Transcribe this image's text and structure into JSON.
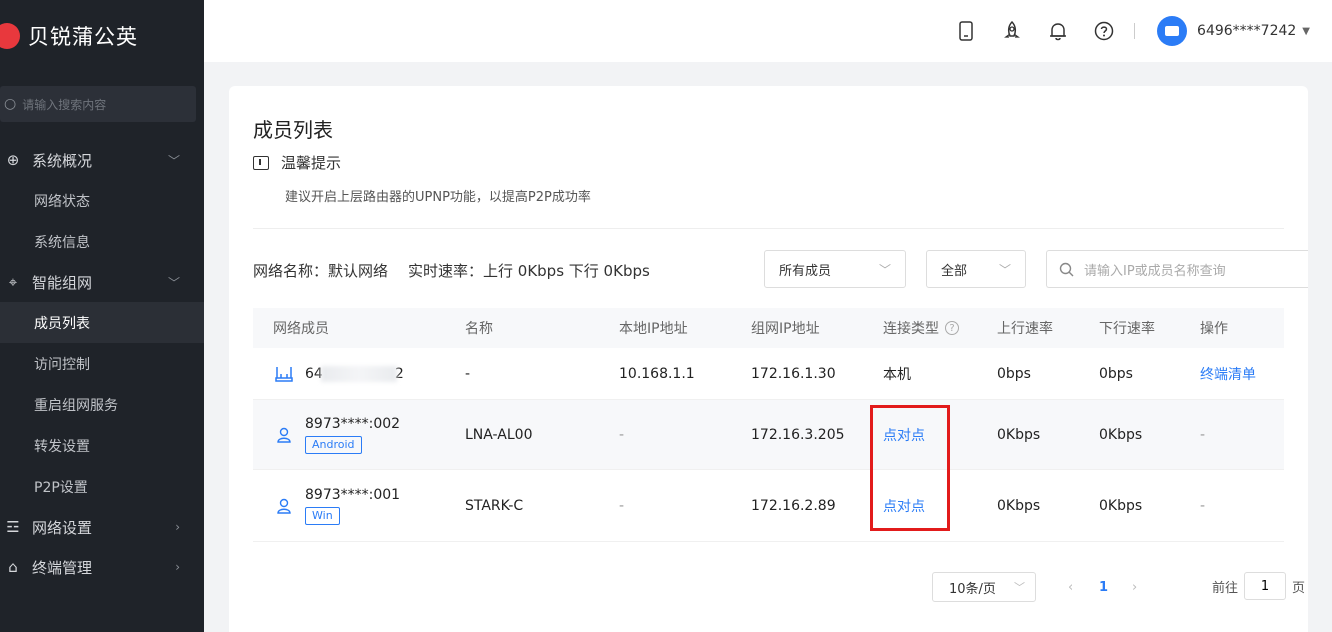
{
  "app": {
    "brand": "贝锐蒲公英"
  },
  "sidebar": {
    "search_placeholder": "请输入搜索内容",
    "groups": [
      {
        "label": "系统概况",
        "icon": "globe-icon",
        "items": [
          "网络状态",
          "系统信息"
        ]
      },
      {
        "label": "智能组网",
        "icon": "network-icon",
        "items": [
          "成员列表",
          "访问控制",
          "重启组网服务",
          "转发设置",
          "P2P设置"
        ]
      },
      {
        "label": "网络设置",
        "icon": "sliders-icon",
        "items": []
      },
      {
        "label": "终端管理",
        "icon": "devices-icon",
        "items": []
      }
    ],
    "active_item": "成员列表"
  },
  "header": {
    "icons": [
      "mobile-icon",
      "rocket-icon",
      "bell-icon",
      "help-icon"
    ],
    "username": "6496****7242"
  },
  "main": {
    "title": "成员列表",
    "tip_title": "温馨提示",
    "tip_text": "建议开启上层路由器的UPNP功能，以提高P2P成功率",
    "network_label": "网络名称：默认网络",
    "speed_label": "实时速率：上行 0Kbps 下行 0Kbps",
    "filter_members": "所有成员",
    "filter_type": "全部",
    "search_placeholder": "请输入IP或成员名称查询"
  },
  "table": {
    "headers": [
      "网络成员",
      "名称",
      "本地IP地址",
      "组网IP地址",
      "连接类型",
      "上行速率",
      "下行速率",
      "操作"
    ],
    "rows": [
      {
        "member_prefix": "64",
        "member_suffix": "2",
        "badge": "",
        "name": "-",
        "local_ip": "10.168.1.1",
        "vpn_ip": "172.16.1.30",
        "conn": "本机",
        "up": "0bps",
        "down": "0bps",
        "action": "终端清单"
      },
      {
        "member": "8973****:002",
        "badge": "Android",
        "name": "LNA-AL00",
        "local_ip": "-",
        "vpn_ip": "172.16.3.205",
        "conn": "点对点",
        "up": "0Kbps",
        "down": "0Kbps",
        "action": "-"
      },
      {
        "member": "8973****:001",
        "badge": "Win",
        "name": "STARK-C",
        "local_ip": "-",
        "vpn_ip": "172.16.2.89",
        "conn": "点对点",
        "up": "0Kbps",
        "down": "0Kbps",
        "action": "-"
      }
    ]
  },
  "pagination": {
    "page_size": "10条/页",
    "current_page": "1",
    "goto_label": "前往",
    "goto_value": "1",
    "page_unit": "页"
  },
  "colors": {
    "accent": "#2b7cf6",
    "sidebar_bg": "#1f2329",
    "highlight_box": "#e21b1b",
    "logo": "#e8383d"
  }
}
